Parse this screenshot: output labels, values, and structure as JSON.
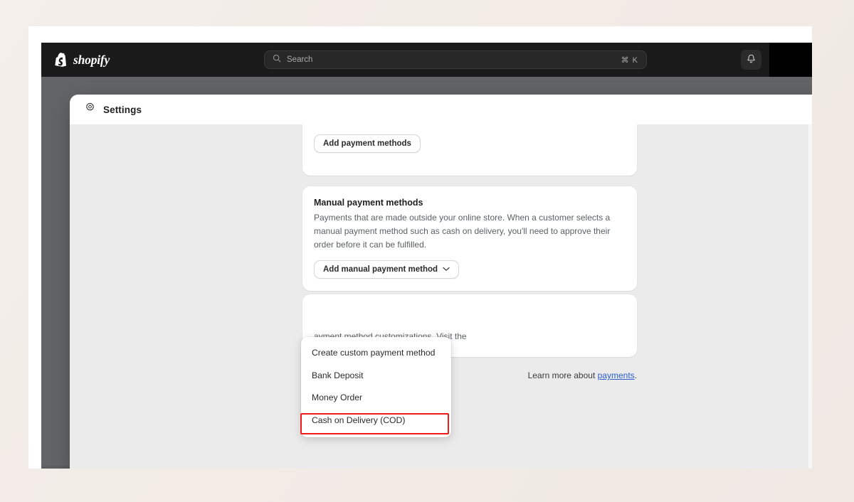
{
  "topbar": {
    "brand_name": "shopify",
    "brand_icon": "shopify-bag-icon",
    "search": {
      "placeholder": "Search",
      "value": "",
      "icon": "search-icon",
      "shortcut": "⌘ K"
    },
    "notifications_icon": "bell-icon",
    "account_label": ""
  },
  "modal": {
    "icon": "gear-icon",
    "title": "Settings",
    "close_label": "✕"
  },
  "content": {
    "payment_methods_card": {
      "add_button_label": "Add payment methods"
    },
    "manual_card": {
      "title": "Manual payment methods",
      "description": "Payments that are made outside your online store. When a customer selects a manual payment method such as cash on delivery, you'll need to approve their order before it can be fulfilled.",
      "add_button_label": "Add manual payment method",
      "add_button_chevron": "chevron-down-icon"
    },
    "customizations_card": {
      "visible_text": "ayment method customizations. Visit the"
    },
    "learn_more": {
      "prefix": "Learn more about ",
      "link_label": "payments",
      "suffix": "."
    }
  },
  "dropdown": {
    "items": [
      {
        "label": "Create custom payment method"
      },
      {
        "label": "Bank Deposit"
      },
      {
        "label": "Money Order"
      },
      {
        "label": "Cash on Delivery (COD)"
      }
    ],
    "highlighted_index": 3,
    "highlight_color": "#ef1b1b"
  },
  "colors": {
    "page_background": "#f2ebe6",
    "topbar": "#1a1a1a",
    "backdrop": "#636466",
    "modal_body": "#ebebeb",
    "card": "#ffffff",
    "link": "#2c5ecf",
    "scrollbar_thumb": "#a6a6a6"
  }
}
